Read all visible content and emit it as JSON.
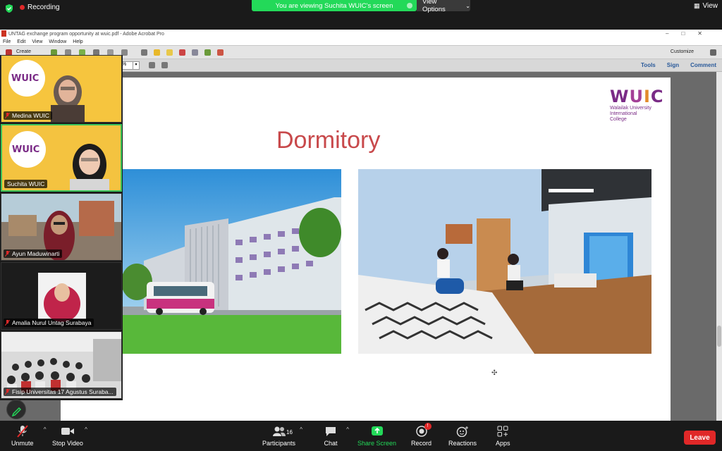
{
  "topbar": {
    "recording_label": "Recording",
    "share_banner": "You are viewing Suchita WUIC's screen",
    "view_options": "View Options",
    "view_button": "View"
  },
  "acrobat": {
    "title": "UNTAG exchange program opportunity at wuic.pdf - Adobe Acrobat Pro",
    "menu": [
      "File",
      "Edit",
      "View",
      "Window",
      "Help"
    ],
    "create_label": "Create",
    "customize_label": "Customize",
    "zoom_value": "%",
    "tools_label": "Tools",
    "sign_label": "Sign",
    "comment_label": "Comment"
  },
  "slide": {
    "title": "Dormitory",
    "logo_mark": [
      "W",
      "U",
      "I",
      "C"
    ],
    "logo_lines": [
      "Walailak University",
      "International",
      "College"
    ]
  },
  "participants": [
    {
      "name": "Medina WUIC",
      "active": false
    },
    {
      "name": "Suchita WUIC",
      "active": true
    },
    {
      "name": "Ayun Maduwinarti",
      "active": false
    },
    {
      "name": "Amalia Nurul Untag Surabaya",
      "active": false
    },
    {
      "name": "Fisip Universitas 17 Agustus Suraba...",
      "active": false
    }
  ],
  "toolbar": {
    "unmute": "Unmute",
    "stop_video": "Stop Video",
    "participants": "Participants",
    "participant_count": "16",
    "chat": "Chat",
    "share_screen": "Share Screen",
    "record": "Record",
    "record_badge": "!",
    "reactions": "Reactions",
    "apps": "Apps",
    "leave": "Leave"
  },
  "colors": {
    "share_green": "#23d959",
    "leave_red": "#e02828",
    "title_red": "#c8494b",
    "brand_purple": "#7a2b86"
  }
}
